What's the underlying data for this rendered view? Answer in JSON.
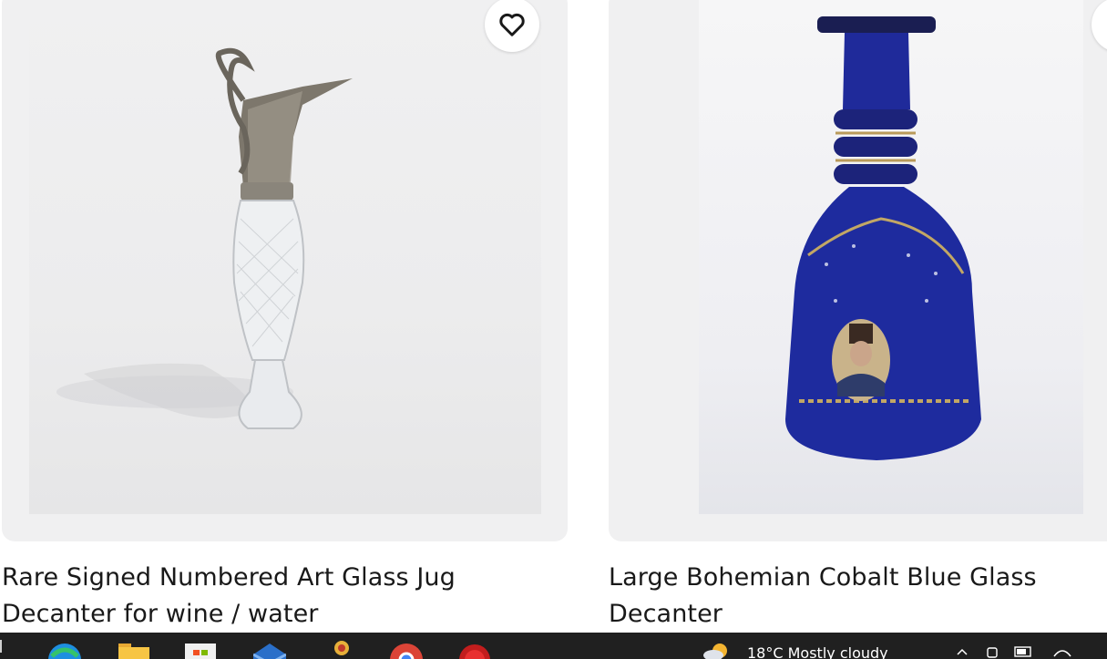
{
  "listings": [
    {
      "title": "Rare Signed Numbered Art Glass Jug Decanter for wine / water",
      "favorite_icon": "heart-outline-icon"
    },
    {
      "title": "Large Bohemian Cobalt Blue Glass Decanter",
      "favorite_icon": "heart-outline-icon"
    }
  ],
  "taskbar": {
    "icons": [
      "edge-icon",
      "file-explorer-icon",
      "store-icon",
      "mail-icon",
      "app-icon",
      "chrome-icon",
      "record-icon"
    ],
    "weather_text": "18°C  Mostly cloudy",
    "colors": {
      "background": "#202020",
      "text": "#ffffff"
    }
  }
}
